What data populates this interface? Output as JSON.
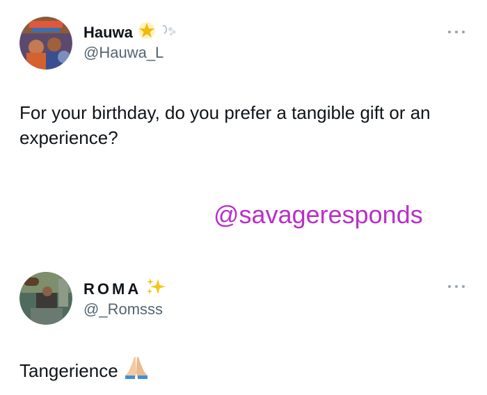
{
  "posts": [
    {
      "display_name": "Hauwa",
      "handle": "@Hauwa_L",
      "text": "For your birthday, do you prefer a tangible gift or an experience?",
      "avatar_icon": "profile-photo-icon",
      "badge_icons": [
        "glowing-star-icon",
        "dash-wind-icon"
      ]
    },
    {
      "display_name": "ROMA",
      "handle": "@_Romsss",
      "text": "Tangerience",
      "avatar_icon": "profile-photo-icon",
      "badge_icons": [
        "sparkles-icon"
      ],
      "trailing_icon": "folded-hands-icon"
    }
  ],
  "watermark": "@savageresponds",
  "colors": {
    "text": "#0f1419",
    "handle": "#536471",
    "watermark": "#b82fc8",
    "more": "#9aa4ad"
  }
}
